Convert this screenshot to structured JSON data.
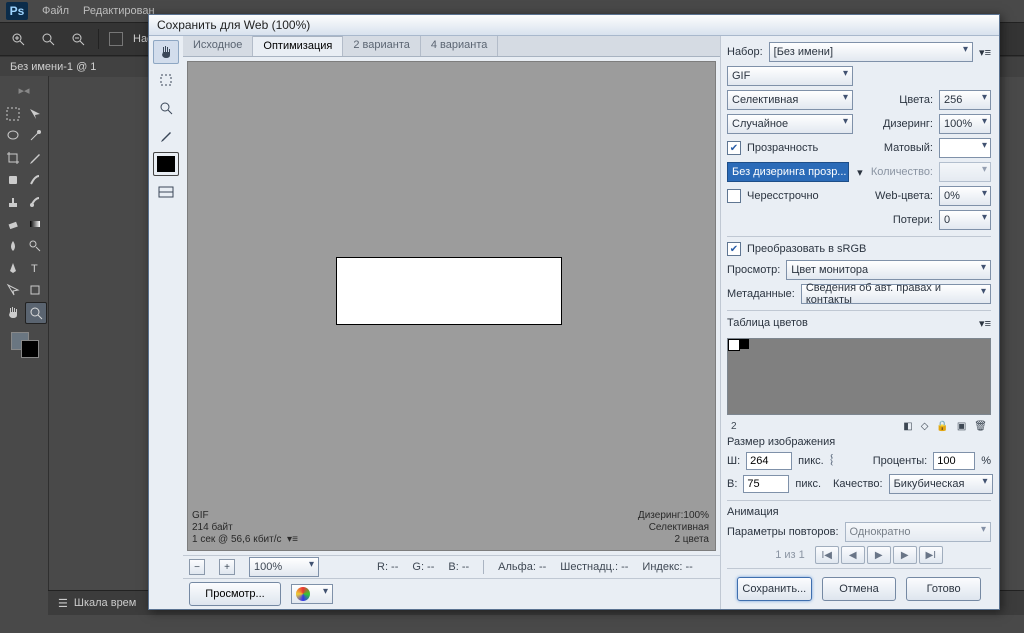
{
  "app_menu": {
    "file": "Файл",
    "edit": "Редактирован"
  },
  "doc_tab": "Без имени-1 @ 1",
  "timeline_label": "Шкала врем",
  "dialog_title": "Сохранить для Web (100%)",
  "sfw": {
    "tabs": {
      "original": "Исходное",
      "optimized": "Оптимизация",
      "two_up": "2 варианта",
      "four_up": "4 варианта"
    },
    "info": {
      "format": "GIF",
      "size_line": "214 байт",
      "time_line": "1 сек @ 56,6 кбит/с",
      "dither_line": "Дизеринг:100%",
      "palette_line": "Селективная",
      "colors_line": "2 цвета"
    },
    "status": {
      "zoom": "100%",
      "r": "R: --",
      "g": "G: --",
      "b": "B: --",
      "alpha": "Альфа: --",
      "hex": "Шестнадц.: --",
      "index": "Индекс: --"
    },
    "right": {
      "preset_label": "Набор:",
      "preset_value": "[Без имени]",
      "format": "GIF",
      "reduction": "Селективная",
      "colors_label": "Цвета:",
      "colors_value": "256",
      "dither_method": "Случайное",
      "dither_label": "Дизеринг:",
      "dither_value": "100%",
      "transparency": "Прозрачность",
      "matte_label": "Матовый:",
      "trans_dither": "Без дизеринга прозр...",
      "amount_label": "Количество:",
      "interlaced": "Чересстрочно",
      "web_snap_label": "Web-цвета:",
      "web_snap_value": "0%",
      "lossy_label": "Потери:",
      "lossy_value": "0",
      "convert_srgb": "Преобразовать в sRGB",
      "preview_label": "Просмотр:",
      "preview_value": "Цвет монитора",
      "metadata_label": "Метаданные:",
      "metadata_value": "Сведения об авт. правах и контакты",
      "color_table_title": "Таблица цветов",
      "color_count": "2",
      "image_size_title": "Размер изображения",
      "w_label": "Ш:",
      "w_value": "264",
      "h_label": "В:",
      "h_value": "75",
      "px": "пикс.",
      "percent_label": "Проценты:",
      "percent_value": "100",
      "pct": "%",
      "quality_label": "Качество:",
      "quality_value": "Бикубическая",
      "animation_title": "Анимация",
      "loop_label": "Параметры повторов:",
      "loop_value": "Однократно",
      "frames": "1 из 1"
    },
    "buttons": {
      "preview": "Просмотр...",
      "save": "Сохранить...",
      "cancel": "Отмена",
      "done": "Готово"
    }
  }
}
